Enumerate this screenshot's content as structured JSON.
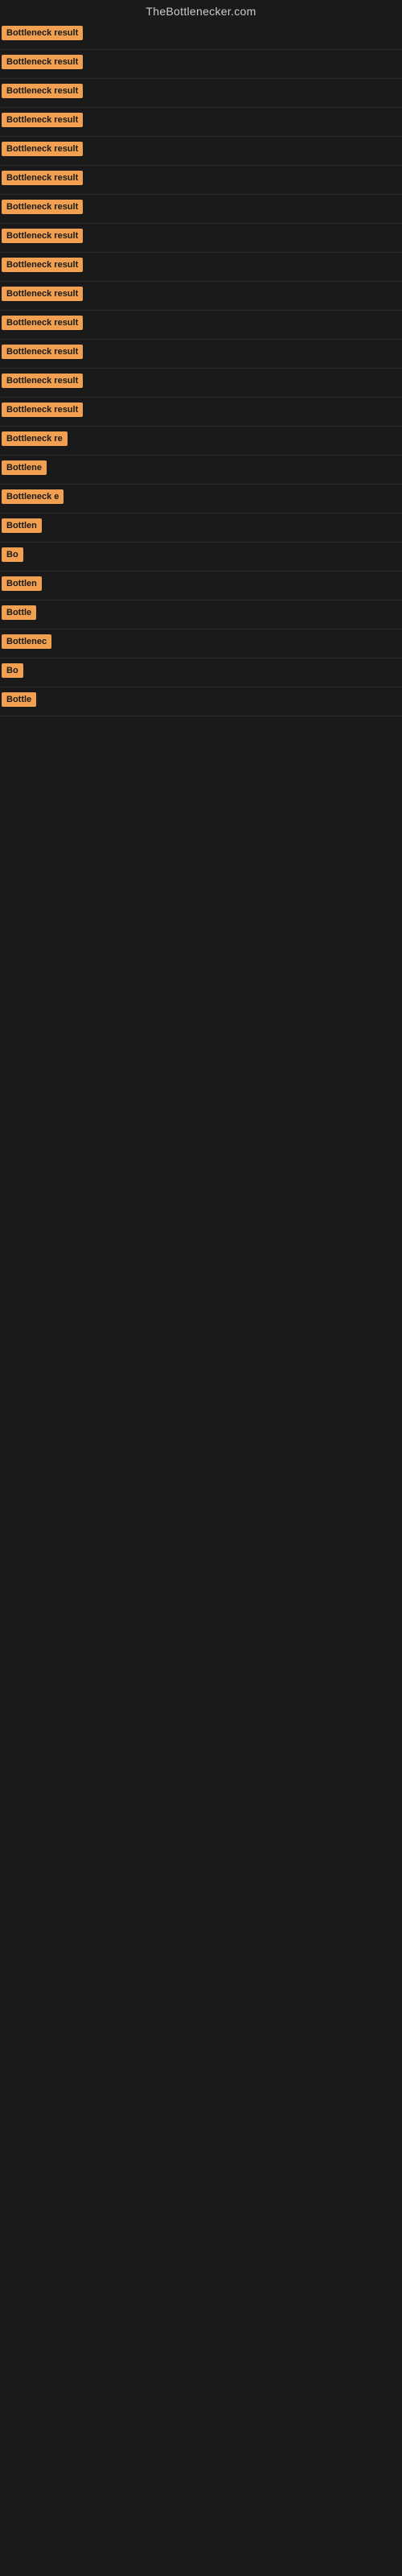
{
  "site": {
    "title": "TheBottlenecker.com"
  },
  "items": [
    {
      "id": 1,
      "label": "Bottleneck result",
      "width": 120
    },
    {
      "id": 2,
      "label": "Bottleneck result",
      "width": 120
    },
    {
      "id": 3,
      "label": "Bottleneck result",
      "width": 120
    },
    {
      "id": 4,
      "label": "Bottleneck result",
      "width": 120
    },
    {
      "id": 5,
      "label": "Bottleneck result",
      "width": 120
    },
    {
      "id": 6,
      "label": "Bottleneck result",
      "width": 120
    },
    {
      "id": 7,
      "label": "Bottleneck result",
      "width": 120
    },
    {
      "id": 8,
      "label": "Bottleneck result",
      "width": 120
    },
    {
      "id": 9,
      "label": "Bottleneck result",
      "width": 120
    },
    {
      "id": 10,
      "label": "Bottleneck result",
      "width": 120
    },
    {
      "id": 11,
      "label": "Bottleneck result",
      "width": 120
    },
    {
      "id": 12,
      "label": "Bottleneck result",
      "width": 120
    },
    {
      "id": 13,
      "label": "Bottleneck result",
      "width": 120
    },
    {
      "id": 14,
      "label": "Bottleneck result",
      "width": 120
    },
    {
      "id": 15,
      "label": "Bottleneck re",
      "width": 95
    },
    {
      "id": 16,
      "label": "Bottlene",
      "width": 72
    },
    {
      "id": 17,
      "label": "Bottleneck e",
      "width": 88
    },
    {
      "id": 18,
      "label": "Bottlen",
      "width": 65
    },
    {
      "id": 19,
      "label": "Bo",
      "width": 28
    },
    {
      "id": 20,
      "label": "Bottlen",
      "width": 65
    },
    {
      "id": 21,
      "label": "Bottle",
      "width": 52
    },
    {
      "id": 22,
      "label": "Bottlenec",
      "width": 78
    },
    {
      "id": 23,
      "label": "Bo",
      "width": 28
    },
    {
      "id": 24,
      "label": "Bottle",
      "width": 52
    }
  ]
}
